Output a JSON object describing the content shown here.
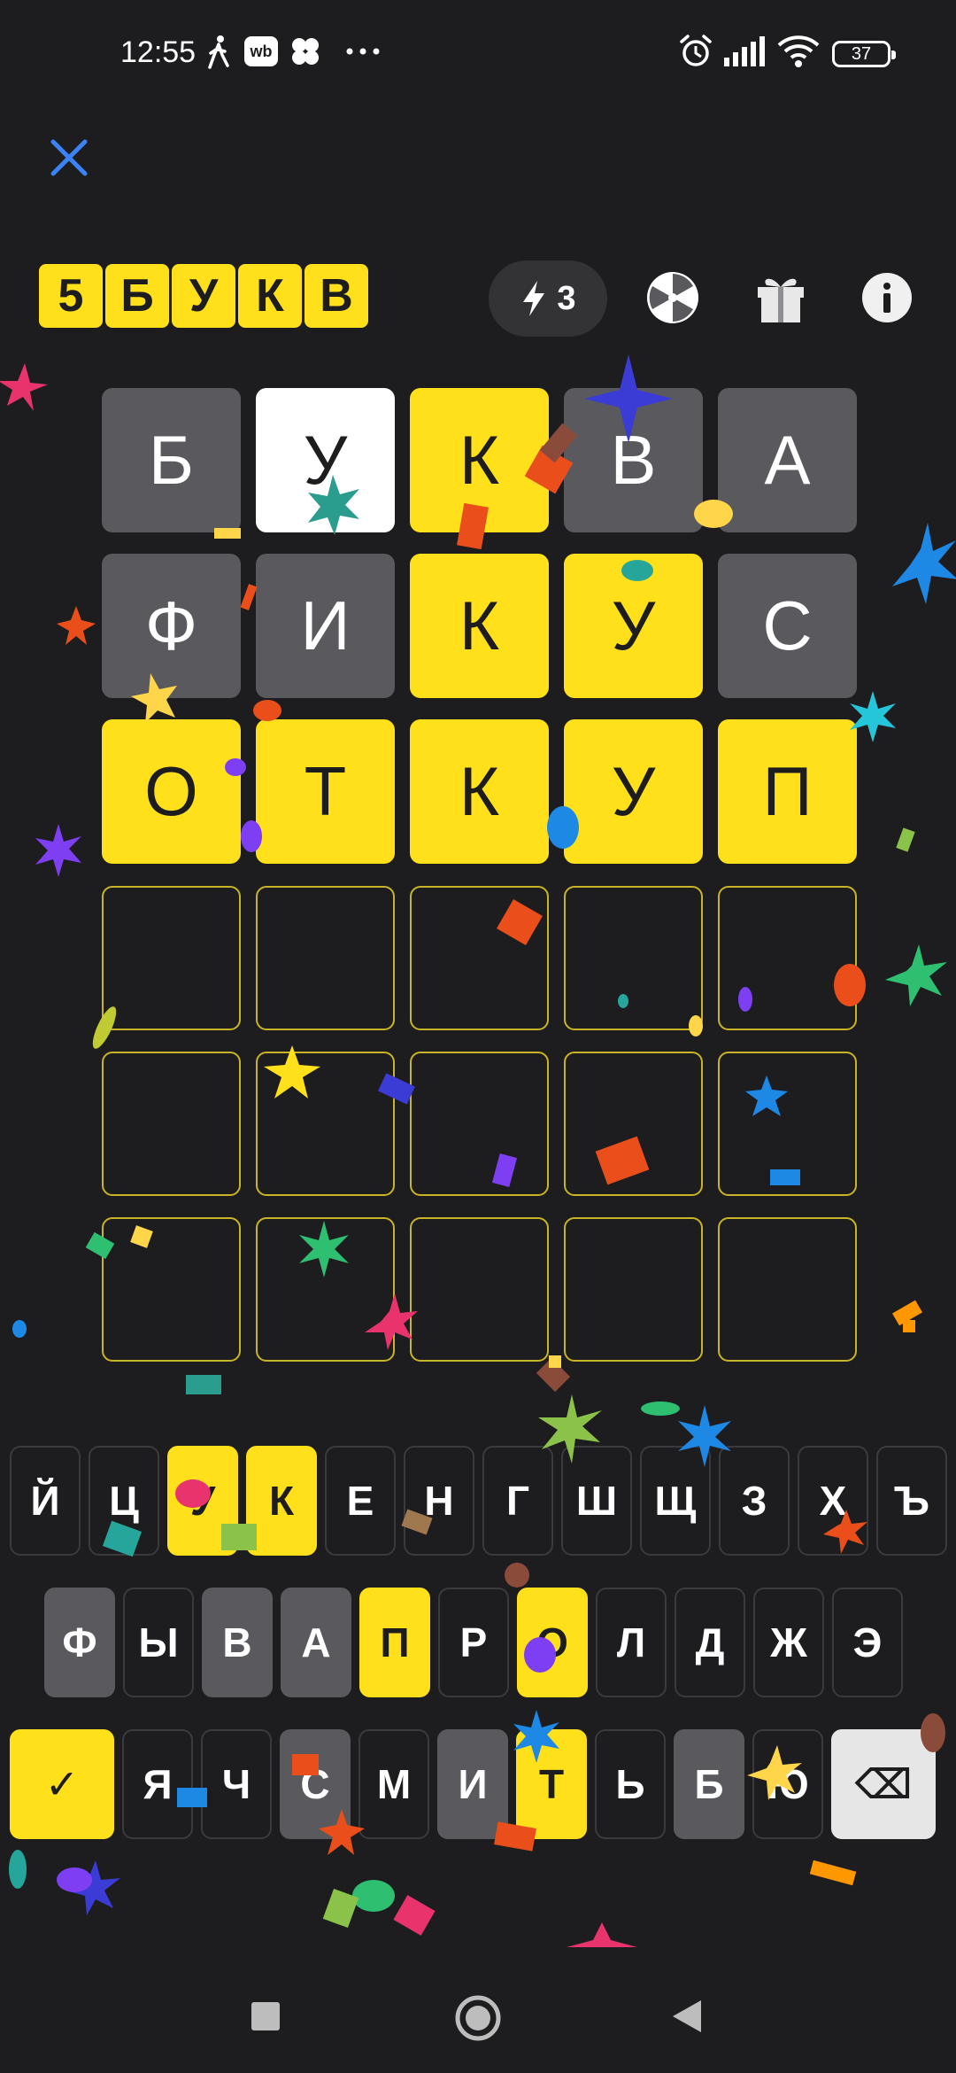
{
  "status_bar": {
    "time": "12:55",
    "left_icons": [
      "walk-icon",
      "wb-app-icon",
      "clover-icon",
      "more-dots-icon"
    ],
    "right_icons": [
      "alarm-icon",
      "signal-icon",
      "wifi-icon"
    ],
    "battery": "37"
  },
  "header": {
    "logo_letters": [
      "5",
      "Б",
      "У",
      "К",
      "В"
    ],
    "hints_count": "3",
    "icons": [
      "lightning-icon",
      "wheel-icon",
      "gift-icon",
      "info-icon"
    ]
  },
  "board": {
    "rows": [
      [
        {
          "letter": "Б",
          "state": "gray"
        },
        {
          "letter": "У",
          "state": "white"
        },
        {
          "letter": "К",
          "state": "yellow"
        },
        {
          "letter": "В",
          "state": "gray"
        },
        {
          "letter": "А",
          "state": "gray"
        }
      ],
      [
        {
          "letter": "Ф",
          "state": "gray"
        },
        {
          "letter": "И",
          "state": "gray"
        },
        {
          "letter": "К",
          "state": "yellow"
        },
        {
          "letter": "У",
          "state": "yellow"
        },
        {
          "letter": "С",
          "state": "gray"
        }
      ],
      [
        {
          "letter": "О",
          "state": "yellow"
        },
        {
          "letter": "Т",
          "state": "yellow"
        },
        {
          "letter": "К",
          "state": "yellow"
        },
        {
          "letter": "У",
          "state": "yellow"
        },
        {
          "letter": "П",
          "state": "yellow"
        }
      ],
      [
        {
          "letter": "",
          "state": "empty"
        },
        {
          "letter": "",
          "state": "empty"
        },
        {
          "letter": "",
          "state": "empty"
        },
        {
          "letter": "",
          "state": "empty"
        },
        {
          "letter": "",
          "state": "empty"
        }
      ],
      [
        {
          "letter": "",
          "state": "empty"
        },
        {
          "letter": "",
          "state": "empty"
        },
        {
          "letter": "",
          "state": "empty"
        },
        {
          "letter": "",
          "state": "empty"
        },
        {
          "letter": "",
          "state": "empty"
        }
      ],
      [
        {
          "letter": "",
          "state": "empty"
        },
        {
          "letter": "",
          "state": "empty"
        },
        {
          "letter": "",
          "state": "empty"
        },
        {
          "letter": "",
          "state": "empty"
        },
        {
          "letter": "",
          "state": "empty"
        }
      ]
    ]
  },
  "keyboard": {
    "row1": [
      {
        "label": "Й",
        "state": "default"
      },
      {
        "label": "Ц",
        "state": "default"
      },
      {
        "label": "У",
        "state": "yellow"
      },
      {
        "label": "К",
        "state": "yellow"
      },
      {
        "label": "Е",
        "state": "default"
      },
      {
        "label": "Н",
        "state": "default"
      },
      {
        "label": "Г",
        "state": "default"
      },
      {
        "label": "Ш",
        "state": "default"
      },
      {
        "label": "Щ",
        "state": "default"
      },
      {
        "label": "З",
        "state": "default"
      },
      {
        "label": "Х",
        "state": "default"
      },
      {
        "label": "Ъ",
        "state": "default"
      }
    ],
    "row2": [
      {
        "label": "Ф",
        "state": "gray"
      },
      {
        "label": "Ы",
        "state": "default"
      },
      {
        "label": "В",
        "state": "gray"
      },
      {
        "label": "А",
        "state": "gray"
      },
      {
        "label": "П",
        "state": "yellow"
      },
      {
        "label": "Р",
        "state": "default"
      },
      {
        "label": "О",
        "state": "yellow"
      },
      {
        "label": "Л",
        "state": "default"
      },
      {
        "label": "Д",
        "state": "default"
      },
      {
        "label": "Ж",
        "state": "default"
      },
      {
        "label": "Э",
        "state": "default"
      }
    ],
    "row3": [
      {
        "label": "✓",
        "state": "yellow",
        "name": "enter-key"
      },
      {
        "label": "Я",
        "state": "default"
      },
      {
        "label": "Ч",
        "state": "default"
      },
      {
        "label": "С",
        "state": "gray"
      },
      {
        "label": "М",
        "state": "default"
      },
      {
        "label": "И",
        "state": "gray"
      },
      {
        "label": "Т",
        "state": "yellow"
      },
      {
        "label": "Ь",
        "state": "default"
      },
      {
        "label": "Б",
        "state": "gray"
      },
      {
        "label": "Ю",
        "state": "default"
      },
      {
        "label": "⌫",
        "state": "light",
        "name": "backspace-key"
      }
    ]
  },
  "nav_bar": {
    "icons": [
      "recents-square-icon",
      "home-circle-icon",
      "back-triangle-icon"
    ]
  },
  "colors": {
    "background": "#1d1d1f",
    "present": "#ffe01b",
    "absent": "#5a5a5e",
    "accent_blue": "#3b82f6"
  }
}
